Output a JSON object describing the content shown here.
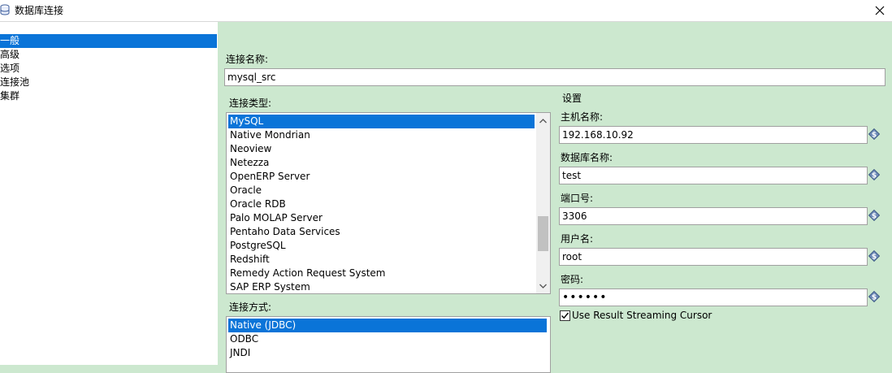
{
  "window": {
    "title": "数据库连接"
  },
  "sidebar": {
    "items": [
      "一般",
      "高级",
      "选项",
      "连接池",
      "集群"
    ],
    "selected": 0
  },
  "form": {
    "connection_name_label": "连接名称:",
    "connection_name_value": "mysql_src",
    "connection_type_label": "连接类型:",
    "connection_types": [
      "MySQL",
      "Native Mondrian",
      "Neoview",
      "Netezza",
      "OpenERP Server",
      "Oracle",
      "Oracle RDB",
      "Palo MOLAP Server",
      "Pentaho Data Services",
      "PostgreSQL",
      "Redshift",
      "Remedy Action Request System",
      "SAP ERP System"
    ],
    "connection_type_selected": 0,
    "access_label": "连接方式:",
    "access_types": [
      "Native (JDBC)",
      "ODBC",
      "JNDI"
    ],
    "access_selected": 0
  },
  "settings": {
    "header": "设置",
    "host_label": "主机名称:",
    "host_value": "192.168.10.92",
    "db_label": "数据库名称:",
    "db_value": "test",
    "port_label": "端口号:",
    "port_value": "3306",
    "user_label": "用户名:",
    "user_value": "root",
    "password_label": "密码:",
    "password_value": "••••••",
    "streaming_label": "Use Result Streaming Cursor",
    "streaming_checked": true
  },
  "colors": {
    "selection": "#0a74d8",
    "background": "#cce8cf"
  }
}
